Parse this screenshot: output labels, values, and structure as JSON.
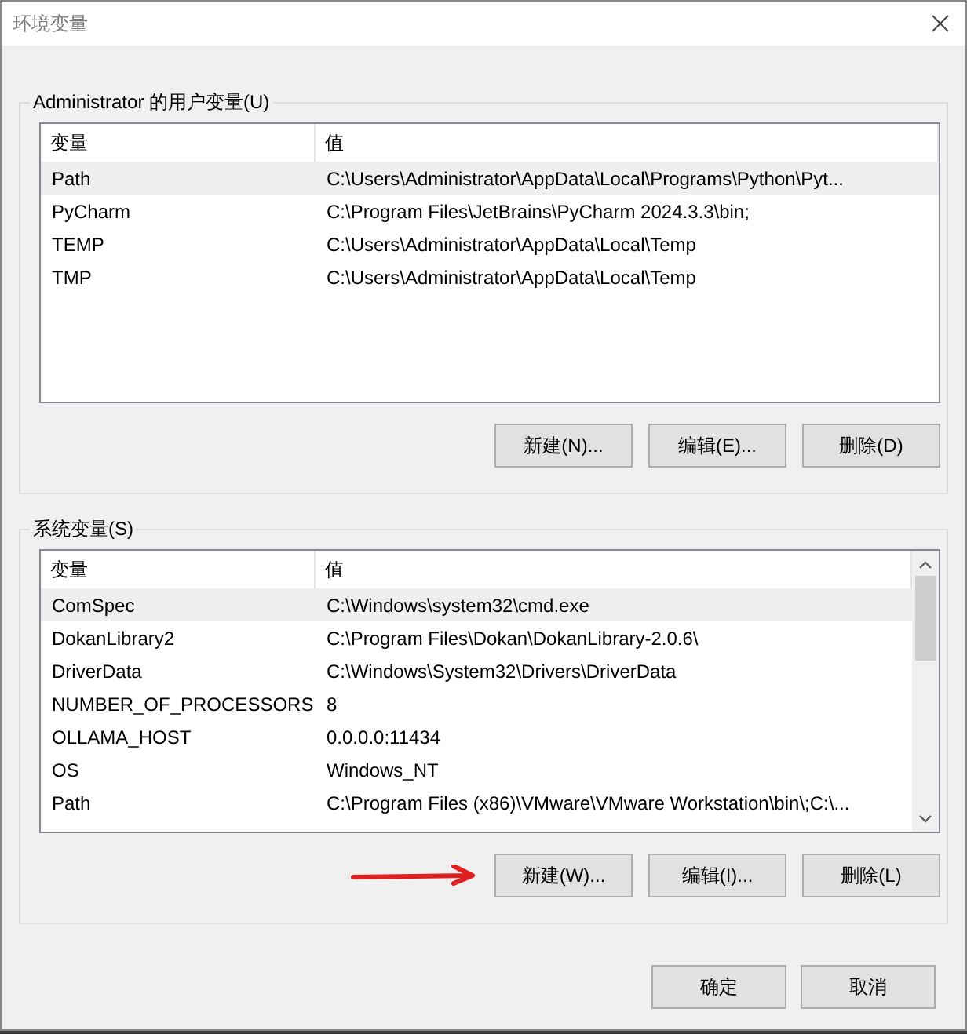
{
  "window": {
    "title": "环境变量"
  },
  "user_vars": {
    "title": "Administrator 的用户变量(U)",
    "columns": [
      "变量",
      "值"
    ],
    "rows": [
      {
        "name": "Path",
        "value": "C:\\Users\\Administrator\\AppData\\Local\\Programs\\Python\\Pyt...",
        "selected": true
      },
      {
        "name": "PyCharm",
        "value": "C:\\Program Files\\JetBrains\\PyCharm 2024.3.3\\bin;",
        "selected": false
      },
      {
        "name": "TEMP",
        "value": "C:\\Users\\Administrator\\AppData\\Local\\Temp",
        "selected": false
      },
      {
        "name": "TMP",
        "value": "C:\\Users\\Administrator\\AppData\\Local\\Temp",
        "selected": false
      }
    ],
    "buttons": [
      "新建(N)...",
      "编辑(E)...",
      "删除(D)"
    ]
  },
  "system_vars": {
    "title": "系统变量(S)",
    "columns": [
      "变量",
      "值"
    ],
    "rows": [
      {
        "name": "ComSpec",
        "value": "C:\\Windows\\system32\\cmd.exe",
        "selected": true
      },
      {
        "name": "DokanLibrary2",
        "value": "C:\\Program Files\\Dokan\\DokanLibrary-2.0.6\\",
        "selected": false
      },
      {
        "name": "DriverData",
        "value": "C:\\Windows\\System32\\Drivers\\DriverData",
        "selected": false
      },
      {
        "name": "NUMBER_OF_PROCESSORS",
        "value": "8",
        "selected": false
      },
      {
        "name": "OLLAMA_HOST",
        "value": "0.0.0.0:11434",
        "selected": false
      },
      {
        "name": "OS",
        "value": "Windows_NT",
        "selected": false
      },
      {
        "name": "Path",
        "value": "C:\\Program Files (x86)\\VMware\\VMware Workstation\\bin\\;C:\\...",
        "selected": false
      }
    ],
    "buttons": [
      "新建(W)...",
      "编辑(I)...",
      "删除(L)"
    ]
  },
  "footer_buttons": [
    "确定",
    "取消"
  ]
}
